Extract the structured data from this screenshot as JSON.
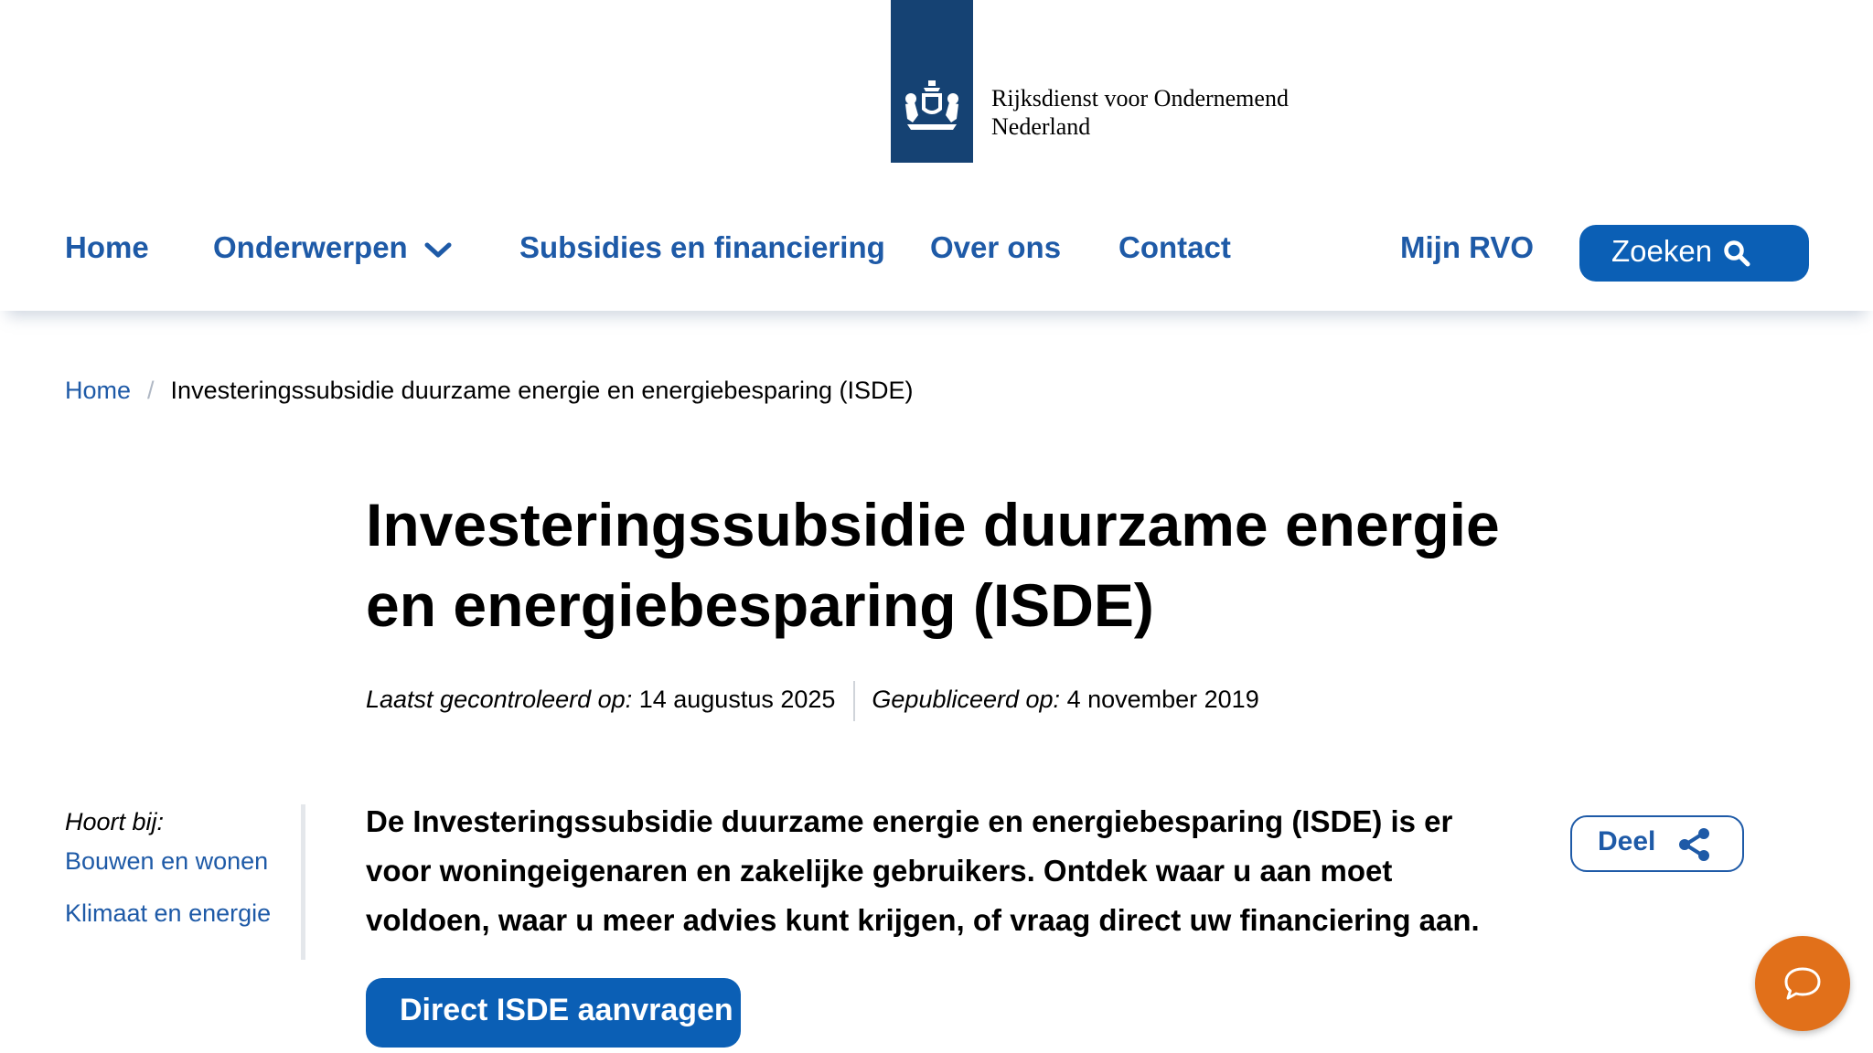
{
  "brand": {
    "line1": "Rijksdienst voor Ondernemend",
    "line2": "Nederland",
    "logo_icon": "royal-coat-of-arms",
    "color": "#154273"
  },
  "nav": {
    "items": [
      {
        "label": "Home"
      },
      {
        "label": "Onderwerpen",
        "icon": "chevron-down-icon"
      },
      {
        "label": "Subsidies en financiering"
      },
      {
        "label": "Over ons"
      },
      {
        "label": "Contact"
      }
    ],
    "mijn": "Mijn RVO",
    "search_label": "Zoeken",
    "search_icon": "search-icon"
  },
  "breadcrumb": {
    "home": "Home",
    "separator": "/",
    "current": "Investeringssubsidie duurzame energie en energiebesparing (ISDE)"
  },
  "page": {
    "title": "Investeringssubsidie duurzame energie en energiebesparing (ISDE)",
    "meta": {
      "checked_label": "Laatst gecontroleerd op:",
      "checked_value": "14 augustus 2025",
      "published_label": "Gepubliceerd op:",
      "published_value": "4 november 2019"
    },
    "intro": "De Investeringssubsidie duurzame energie en energiebesparing (ISDE) is er voor woningeigenaren en zakelijke gebruikers. Ontdek waar u aan moet voldoen, waar u meer advies kunt krijgen, of vraag direct uw financiering aan.",
    "cta_label": "Direct ISDE aanvragen"
  },
  "aside": {
    "label": "Hoort bij:",
    "topics": [
      "Bouwen en wonen",
      "Klimaat en energie"
    ]
  },
  "share": {
    "label": "Deel",
    "icon": "share-icon"
  },
  "chat": {
    "icon": "chat-bubble-icon",
    "color": "#e1701a"
  },
  "colors": {
    "link": "#1e5aa7",
    "button": "#0b5fb5"
  }
}
